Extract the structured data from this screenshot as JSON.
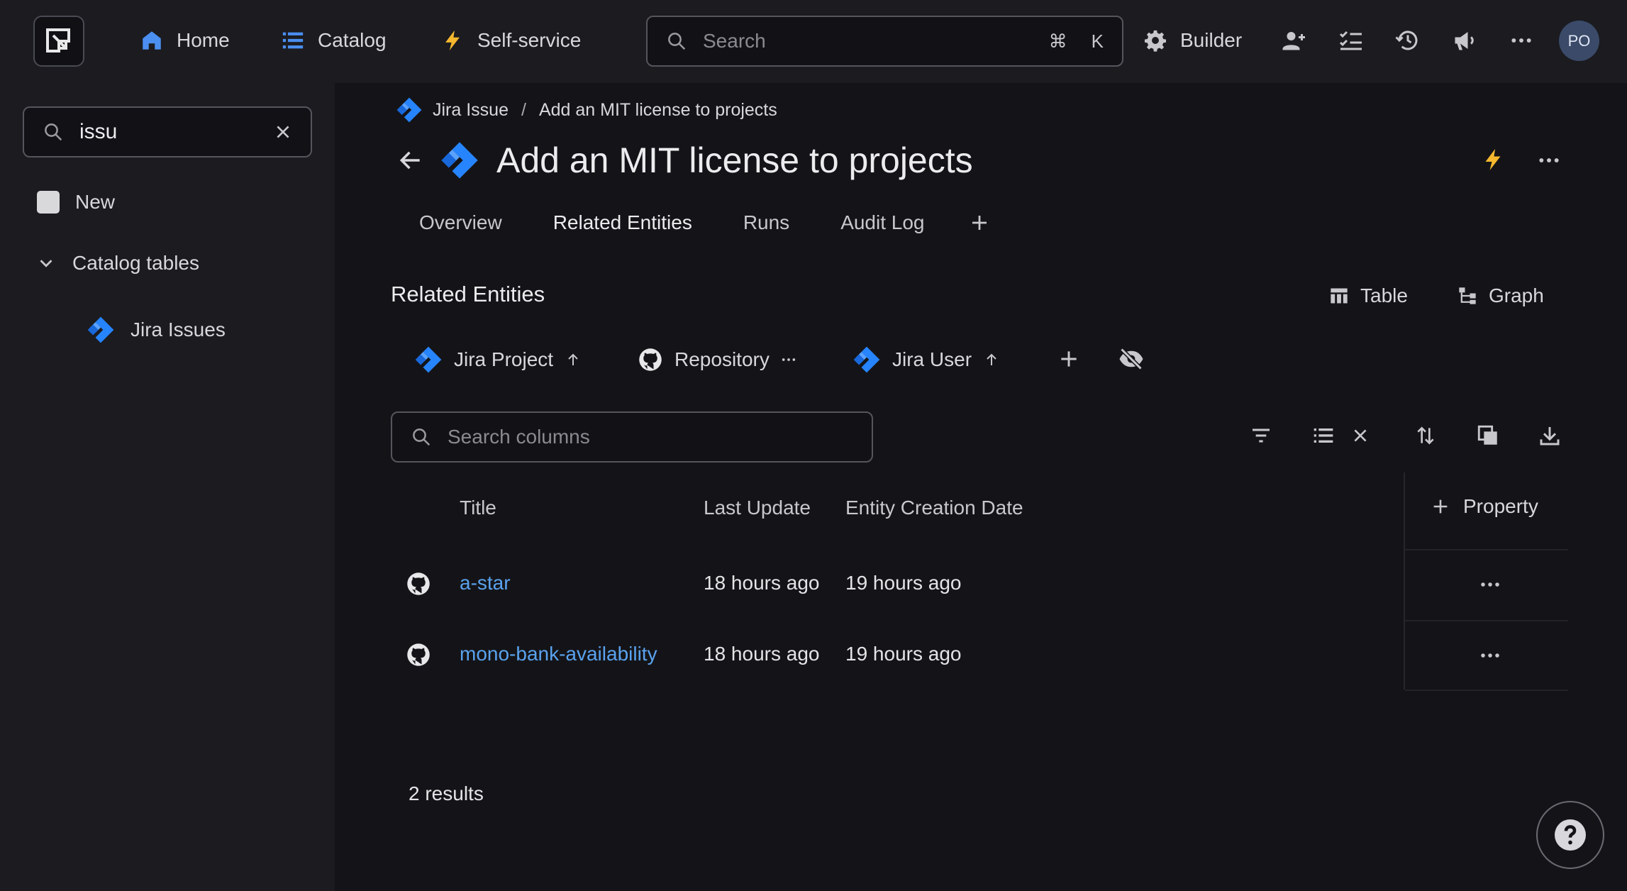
{
  "nav": {
    "home": "Home",
    "catalog": "Catalog",
    "self_service": "Self-service",
    "search_placeholder": "Search",
    "shortcut_cmd": "⌘",
    "shortcut_key": "K",
    "builder": "Builder",
    "avatar_initials": "PO",
    "icons": [
      "home-icon",
      "catalog-list-icon",
      "lightning-icon",
      "search-icon",
      "gear-icon",
      "add-user-icon",
      "checklist-icon",
      "history-icon",
      "announcement-icon",
      "more-icon"
    ]
  },
  "sidebar": {
    "search_value": "issu",
    "items": [
      {
        "label": "New"
      },
      {
        "label": "Catalog tables"
      },
      {
        "label": "Jira Issues"
      }
    ]
  },
  "breadcrumb": {
    "parent": "Jira Issue",
    "separator": "/",
    "current": "Add an MIT license to projects"
  },
  "page": {
    "title": "Add an MIT license to projects",
    "tabs": [
      "Overview",
      "Related Entities",
      "Runs",
      "Audit Log"
    ],
    "active_tab": "Related Entities"
  },
  "related": {
    "title": "Related Entities",
    "view_table": "Table",
    "view_graph": "Graph",
    "relation_tabs": [
      {
        "label": "Jira Project"
      },
      {
        "label": "Repository"
      },
      {
        "label": "Jira User"
      }
    ],
    "search_placeholder": "Search columns"
  },
  "table": {
    "columns": [
      "Title",
      "Last Update",
      "Entity Creation Date"
    ],
    "add_property": "Property",
    "rows": [
      {
        "title": "a-star",
        "last_update": "18 hours ago",
        "created": "19 hours ago"
      },
      {
        "title": "mono-bank-availability",
        "last_update": "18 hours ago",
        "created": "19 hours ago"
      }
    ],
    "results_label": "2 results"
  },
  "colors": {
    "background": "#141418",
    "panel": "#1b1b20",
    "link": "#5aa2ee",
    "jira_blue": "#2684ff",
    "accent_yellow": "#f5b82e"
  }
}
